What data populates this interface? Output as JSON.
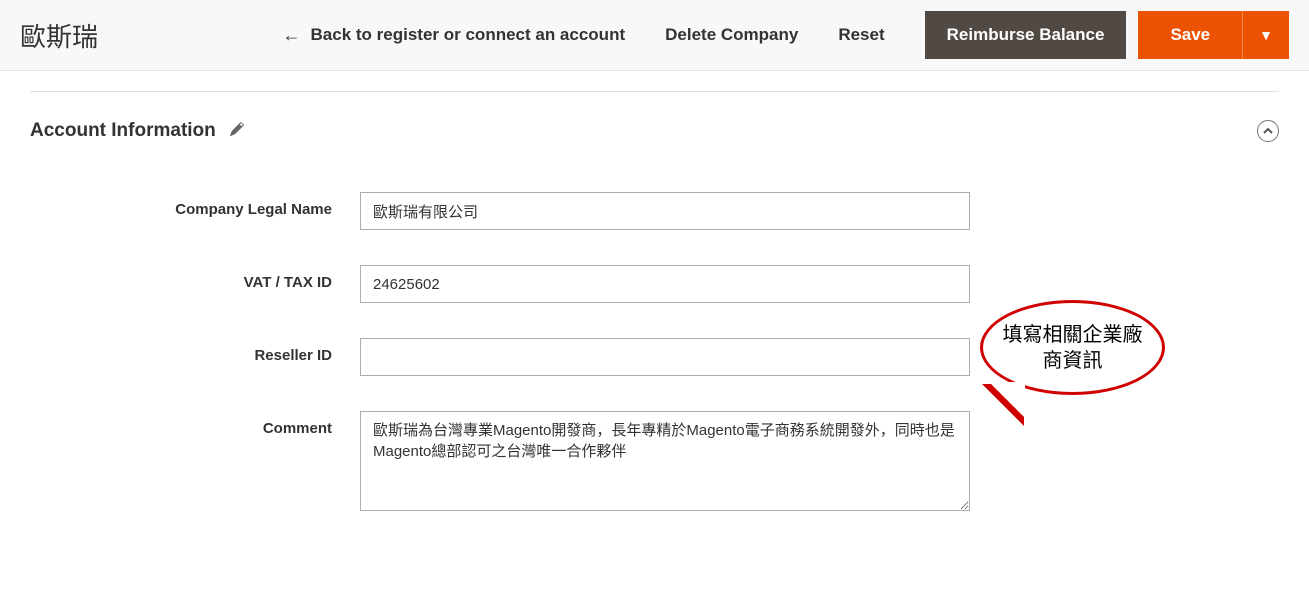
{
  "header": {
    "brand": "歐斯瑞",
    "back_label": "Back to register or connect an account",
    "delete_label": "Delete Company",
    "reset_label": "Reset",
    "reimburse_label": "Reimburse Balance",
    "save_label": "Save"
  },
  "section": {
    "title": "Account Information"
  },
  "form": {
    "legal_name_label": "Company Legal Name",
    "legal_name_value": "歐斯瑞有限公司",
    "vat_label": "VAT / TAX ID",
    "vat_value": "24625602",
    "reseller_label": "Reseller ID",
    "reseller_value": "",
    "comment_label": "Comment",
    "comment_value": "歐斯瑞為台灣專業Magento開發商，長年專精於Magento電子商務系統開發外，同時也是Magento總部認可之台灣唯一合作夥伴"
  },
  "callout": {
    "text": "填寫相關企業廠商資訊"
  }
}
